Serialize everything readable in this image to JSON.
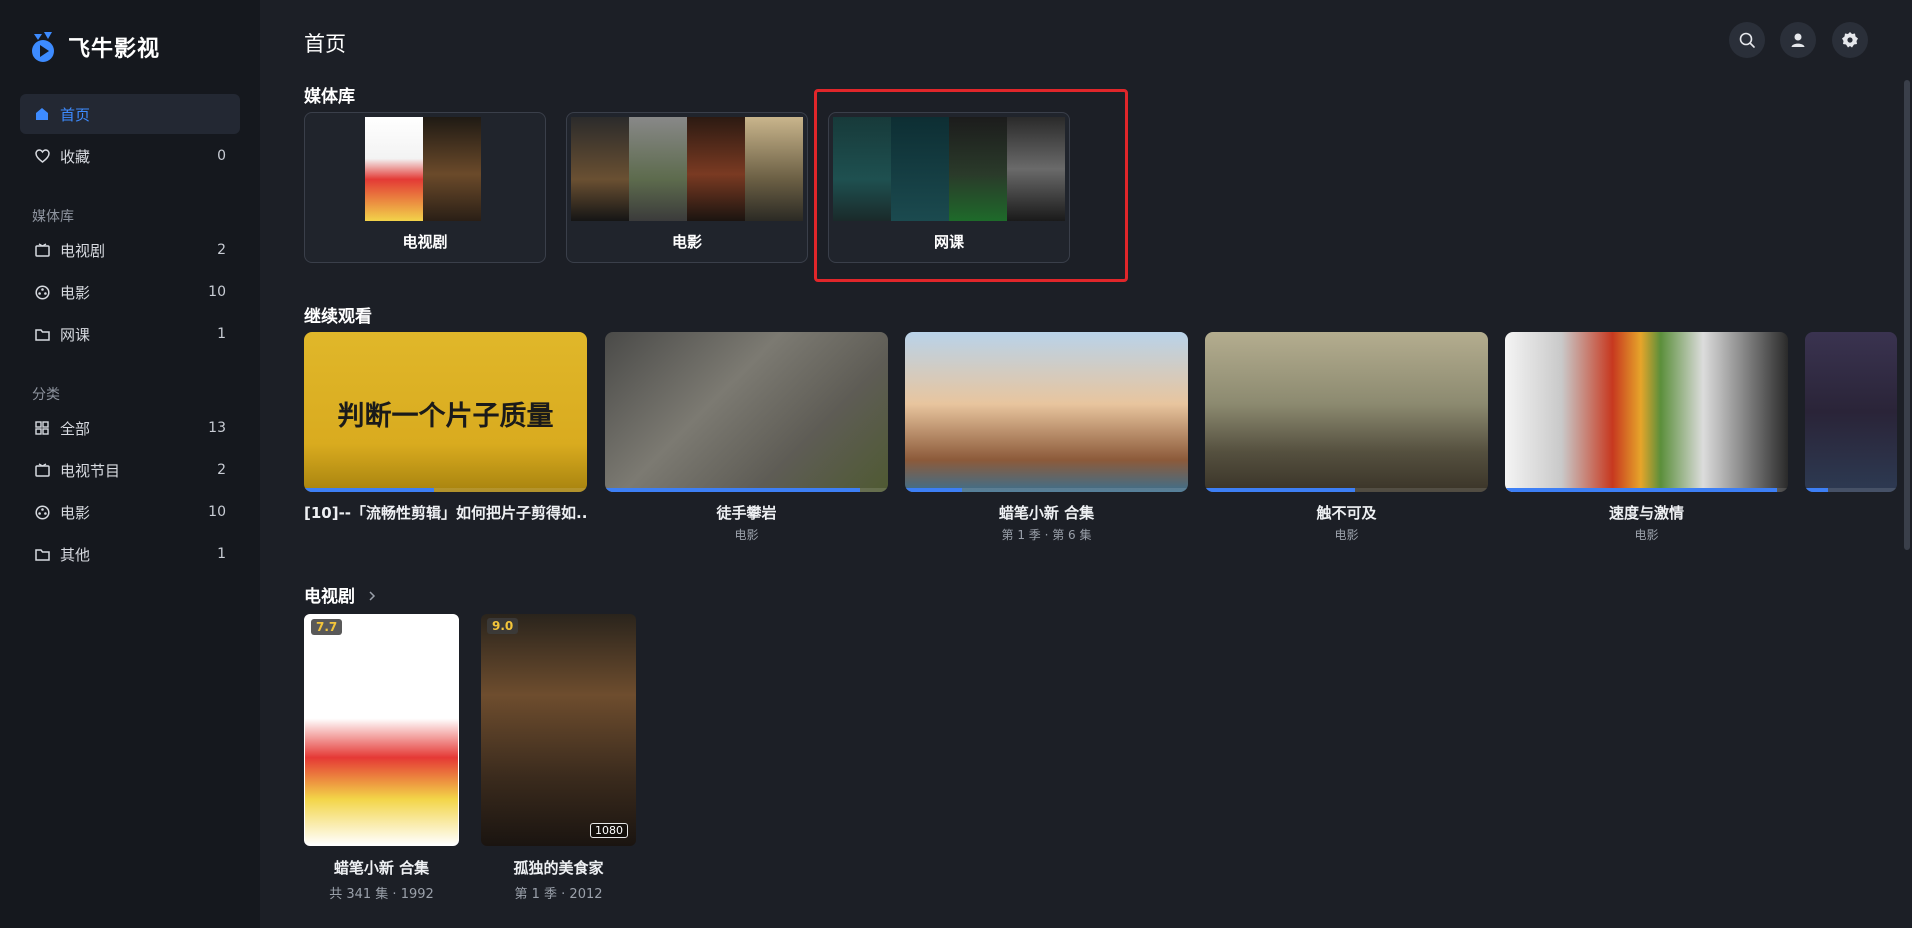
{
  "app": {
    "name": "飞牛影视"
  },
  "sidebar": {
    "home": {
      "label": "首页"
    },
    "favorites": {
      "label": "收藏",
      "count": "0"
    },
    "library_section": "媒体库",
    "libraries": [
      {
        "label": "电视剧",
        "count": "2",
        "icon": "tv-icon"
      },
      {
        "label": "电影",
        "count": "10",
        "icon": "film-reel-icon"
      },
      {
        "label": "网课",
        "count": "1",
        "icon": "folder-icon"
      }
    ],
    "category_section": "分类",
    "categories": [
      {
        "label": "全部",
        "count": "13",
        "icon": "grid-icon"
      },
      {
        "label": "电视节目",
        "count": "2",
        "icon": "tv-icon"
      },
      {
        "label": "电影",
        "count": "10",
        "icon": "film-reel-icon"
      },
      {
        "label": "其他",
        "count": "1",
        "icon": "folder-icon"
      }
    ]
  },
  "header": {
    "title": "首页"
  },
  "media_library": {
    "title": "媒体库",
    "cards": [
      {
        "label": "电视剧"
      },
      {
        "label": "电影"
      },
      {
        "label": "网课"
      }
    ]
  },
  "continue_watching": {
    "title": "继续观看",
    "items": [
      {
        "title": "[10]--「流畅性剪辑」如何把片子剪得如...",
        "subtitle": "",
        "overlay_text": "判断一个片子质量",
        "progress": 0.46
      },
      {
        "title": "徒手攀岩",
        "subtitle": "电影",
        "progress": 0.9
      },
      {
        "title": "蜡笔小新 合集",
        "subtitle": "第 1 季 · 第 6 集",
        "progress": 0.2
      },
      {
        "title": "触不可及",
        "subtitle": "电影",
        "progress": 0.53
      },
      {
        "title": "速度与激情",
        "subtitle": "电影",
        "progress": 0.96
      },
      {
        "title": "",
        "subtitle": "",
        "progress": 0.25
      }
    ]
  },
  "tv_shows": {
    "title": "电视剧",
    "items": [
      {
        "title": "蜡笔小新 合集",
        "subtitle": "共 341 集 · 1992",
        "rating": "7.7"
      },
      {
        "title": "孤独的美食家",
        "subtitle": "第 1 季 · 2012",
        "rating": "9.0",
        "resolution": "1080"
      }
    ]
  },
  "colors": {
    "accent": "#3d8bff",
    "highlight_border": "#e0262a",
    "background": "#1c1f26",
    "sidebar": "#15181e"
  }
}
